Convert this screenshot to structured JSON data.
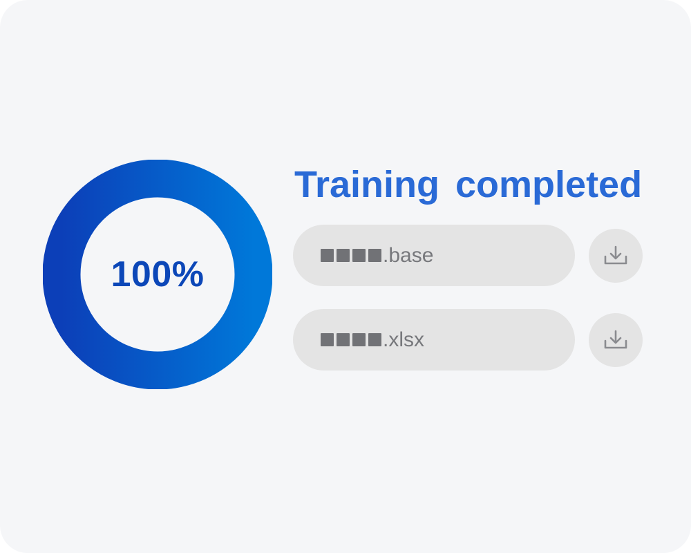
{
  "progress": {
    "label": "100%",
    "fraction": 1.0,
    "color_start": "#0c3fb8",
    "color_end": "#0078d9"
  },
  "title": "Training  completed",
  "accent_color": "#2a6ad6",
  "files": [
    {
      "masked_prefix": "■■■■",
      "extension": ".base",
      "action_icon": "download-icon"
    },
    {
      "masked_prefix": "■■■■",
      "extension": ".xlsx",
      "action_icon": "download-icon"
    }
  ]
}
